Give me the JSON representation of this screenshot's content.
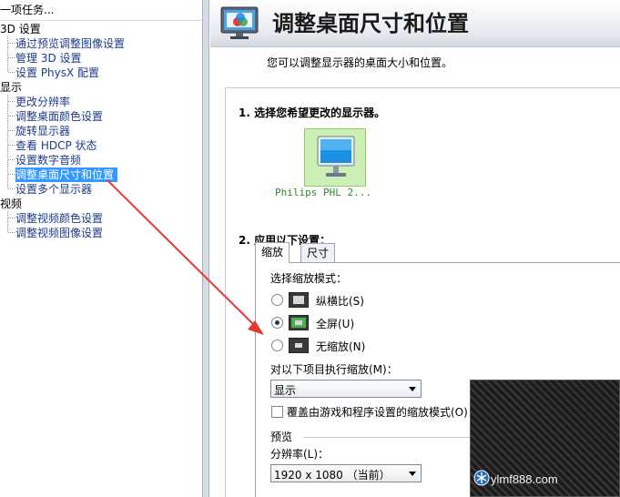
{
  "sidebar": {
    "header": "一项任务...",
    "categories": [
      {
        "label": "3D 设置",
        "items": [
          "通过预览调整图像设置",
          "管理 3D 设置",
          "设置 PhysX 配置"
        ]
      },
      {
        "label": "显示",
        "items": [
          "更改分辨率",
          "调整桌面颜色设置",
          "旋转显示器",
          "查看 HDCP 状态",
          "设置数字音频",
          "调整桌面尺寸和位置",
          "设置多个显示器"
        ]
      },
      {
        "label": "视频",
        "items": [
          "调整视频颜色设置",
          "调整视频图像设置"
        ]
      }
    ],
    "selected_item": "调整桌面尺寸和位置"
  },
  "page": {
    "title": "调整桌面尺寸和位置",
    "subtitle": "您可以调整显示器的桌面大小和位置。",
    "step1": "1. 选择您希望更改的显示器。",
    "monitor_name": "Philips PHL 2...",
    "step2": "2. 应用以下设置："
  },
  "tabs": [
    "缩放",
    "尺寸"
  ],
  "scaling": {
    "mode_label": "选择缩放模式：",
    "modes": [
      "纵横比(S)",
      "全屏(U)",
      "无缩放(N)"
    ],
    "selected_mode": "全屏(U)",
    "perform_on_label": "对以下项目执行缩放(M)：",
    "perform_on_value": "显示",
    "override_label": "覆盖由游戏和程序设置的缩放模式(O)",
    "override_checked": false,
    "preview_label": "预览",
    "resolution_label": "分辨率(L)：",
    "resolution_value": "1920 x 1080 （当前）"
  },
  "watermark": "ylmf888.com",
  "colors": {
    "selection": "#3399ff",
    "link": "#1d3a8a",
    "monitor_tile": "#ccefb5",
    "monitor_text": "#2a8a2a",
    "annotation_arrow": "#e53935"
  }
}
